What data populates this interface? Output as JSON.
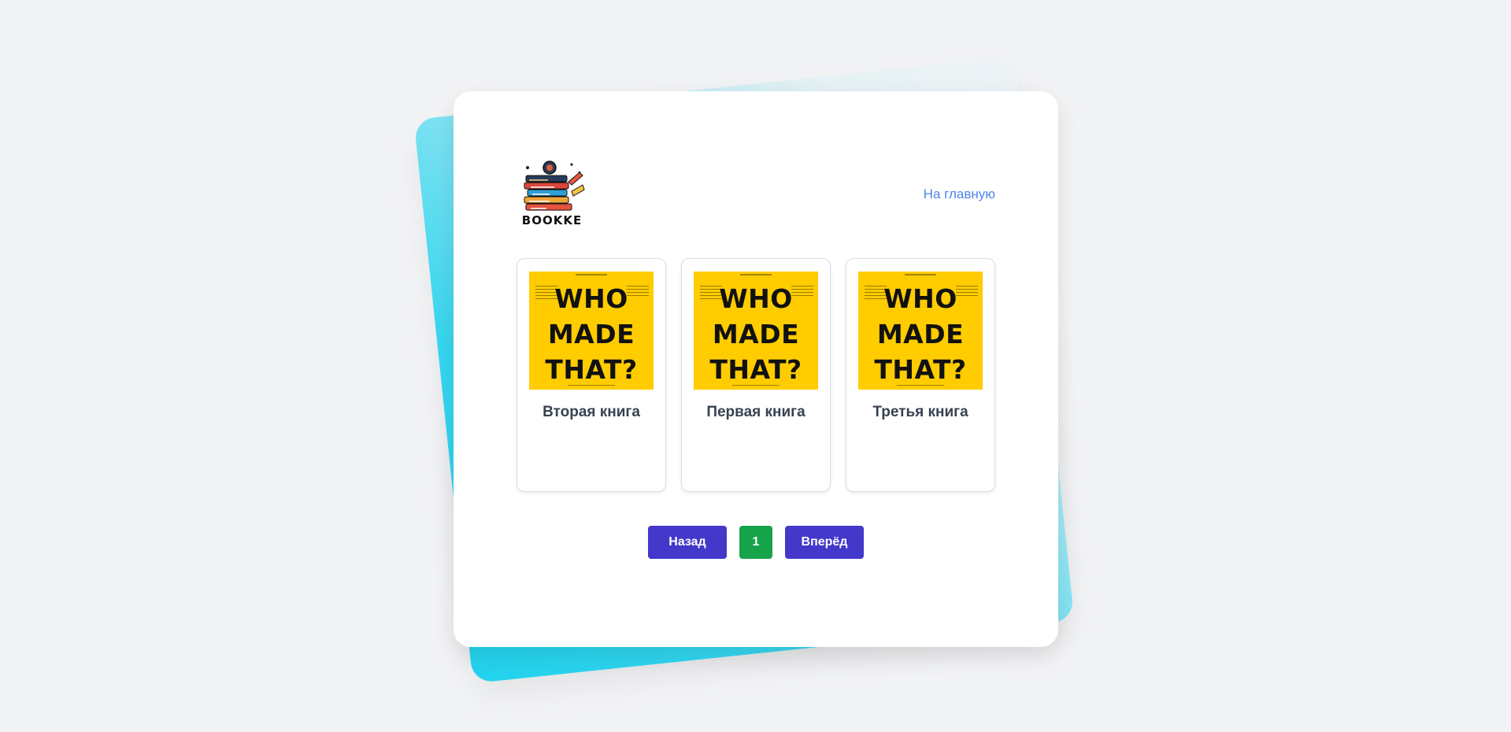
{
  "header": {
    "logo_alt": "BOOKKE",
    "home_link_label": "На главную"
  },
  "books": [
    {
      "title": "Вторая книга",
      "cover_text": "WHO MADE THAT?"
    },
    {
      "title": "Первая книга",
      "cover_text": "WHO MADE THAT?"
    },
    {
      "title": "Третья книга",
      "cover_text": "WHO MADE THAT?"
    }
  ],
  "pagination": {
    "prev_label": "Назад",
    "current_page": "1",
    "next_label": "Вперёд"
  },
  "colors": {
    "link": "#4f86e8",
    "nav_button": "#4338ca",
    "page_button": "#16a34a",
    "cover": "#ffcc00",
    "accent_bg": "#22d3ee"
  }
}
